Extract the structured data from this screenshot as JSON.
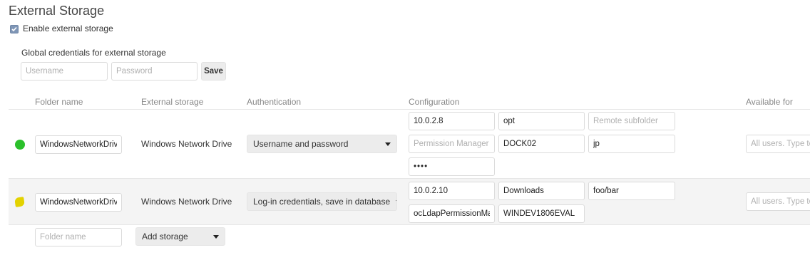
{
  "section": {
    "title": "External Storage",
    "enable_label": "Enable external storage",
    "enable_checked": true
  },
  "global_credentials": {
    "label": "Global credentials for external storage",
    "username_placeholder": "Username",
    "password_placeholder": "Password",
    "save_label": "Save"
  },
  "table": {
    "headers": {
      "folder_name": "Folder name",
      "external_storage": "External storage",
      "authentication": "Authentication",
      "configuration": "Configuration",
      "available_for": "Available for"
    },
    "rows": [
      {
        "status": "ok",
        "status_color": "#2bc02b",
        "folder_name": "WindowsNetworkDriv",
        "storage": "Windows Network Drive",
        "auth": "Username and password",
        "config": {
          "host": "10.0.2.8",
          "share": "opt",
          "remote_subfolder_placeholder": "Remote subfolder",
          "remote_subfolder": "",
          "permission_manager_placeholder": "Permission Manager",
          "permission_manager": "",
          "domain": "DOCK02",
          "user": "jp",
          "password": "••••"
        },
        "available_placeholder": "All users. Type to select user or group."
      },
      {
        "status": "warning",
        "status_color": "#e3d200",
        "folder_name": "WindowsNetworkDriv",
        "storage": "Windows Network Drive",
        "auth": "Log-in credentials, save in database",
        "config": {
          "host": "10.0.2.10",
          "share": "Downloads",
          "remote_subfolder": "foo/bar",
          "permission_manager": "ocLdapPermissionMa",
          "domain": "WINDEV1806EVAL"
        },
        "available_placeholder": "All users. Type to select user or group."
      }
    ],
    "new_row": {
      "folder_placeholder": "Folder name",
      "add_storage_label": "Add storage"
    }
  },
  "colors": {
    "accent_checkbox": "#7f96b6",
    "status_ok": "#2bc02b",
    "status_warning": "#e3d200"
  }
}
